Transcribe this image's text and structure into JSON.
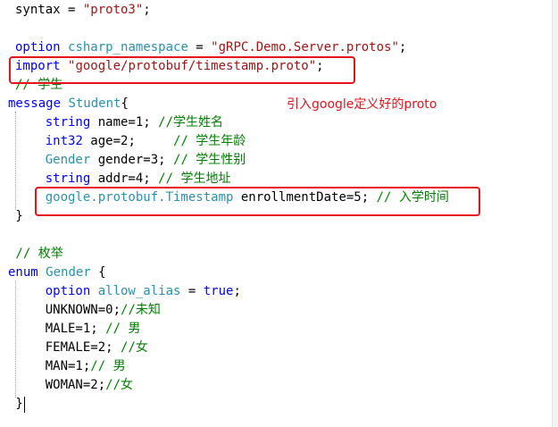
{
  "editor": {
    "lines": [
      [
        {
          "t": "syntax = ",
          "c": "pl"
        },
        {
          "t": "\"proto3\"",
          "c": "str"
        },
        {
          "t": ";",
          "c": "pl"
        }
      ],
      [],
      [
        {
          "t": "option ",
          "c": "kw"
        },
        {
          "t": "csharp_namespace",
          "c": "ty"
        },
        {
          "t": " = ",
          "c": "pl"
        },
        {
          "t": "\"gRPC.Demo.Server.protos\"",
          "c": "str"
        },
        {
          "t": ";",
          "c": "pl"
        }
      ],
      [
        {
          "t": "import ",
          "c": "kw"
        },
        {
          "t": "\"google/protobuf/timestamp.proto\"",
          "c": "str"
        },
        {
          "t": ";",
          "c": "pl"
        }
      ],
      [
        {
          "t": "// 学生",
          "c": "cm"
        }
      ],
      [
        {
          "t": "message ",
          "c": "kw"
        },
        {
          "t": "Student",
          "c": "ty"
        },
        {
          "t": "{",
          "c": "pl"
        }
      ],
      [
        {
          "t": "    string ",
          "c": "kw"
        },
        {
          "t": "name=1; ",
          "c": "pl"
        },
        {
          "t": "//学生姓名",
          "c": "cm"
        }
      ],
      [
        {
          "t": "    int32 ",
          "c": "kw"
        },
        {
          "t": "age=2;     ",
          "c": "pl"
        },
        {
          "t": "// 学生年龄",
          "c": "cm"
        }
      ],
      [
        {
          "t": "    Gender ",
          "c": "ty"
        },
        {
          "t": "gender=3; ",
          "c": "pl"
        },
        {
          "t": "// 学生性别",
          "c": "cm"
        }
      ],
      [
        {
          "t": "    string ",
          "c": "kw"
        },
        {
          "t": "addr=4; ",
          "c": "pl"
        },
        {
          "t": "// 学生地址",
          "c": "cm"
        }
      ],
      [
        {
          "t": "    google.protobuf.",
          "c": "ty"
        },
        {
          "t": "Timestamp",
          "c": "ty"
        },
        {
          "t": " enrollmentDate=5; ",
          "c": "pl"
        },
        {
          "t": "// 入学时间",
          "c": "cm"
        }
      ],
      [
        {
          "t": " }",
          "c": "pl"
        }
      ],
      [],
      [
        {
          "t": " // 枚举",
          "c": "cm"
        }
      ],
      [
        {
          "t": "enum ",
          "c": "kw"
        },
        {
          "t": "Gender",
          "c": "ty"
        },
        {
          "t": " {",
          "c": "pl"
        }
      ],
      [
        {
          "t": "    option ",
          "c": "kw"
        },
        {
          "t": "allow_alias",
          "c": "ty"
        },
        {
          "t": " = ",
          "c": "pl"
        },
        {
          "t": "true",
          "c": "kw"
        },
        {
          "t": ";",
          "c": "pl"
        }
      ],
      [
        {
          "t": "    UNKNOWN=0;",
          "c": "pl"
        },
        {
          "t": "//未知",
          "c": "cm"
        }
      ],
      [
        {
          "t": "    MALE=1; ",
          "c": "pl"
        },
        {
          "t": "// 男",
          "c": "cm"
        }
      ],
      [
        {
          "t": "    FEMALE=2; ",
          "c": "pl"
        },
        {
          "t": "//女",
          "c": "cm"
        }
      ],
      [
        {
          "t": "    MAN=1;",
          "c": "pl"
        },
        {
          "t": "// 男",
          "c": "cm"
        }
      ],
      [
        {
          "t": "    WOMAN=2;",
          "c": "pl"
        },
        {
          "t": "//女",
          "c": "cm"
        }
      ],
      [
        {
          "t": " }",
          "c": "pl"
        }
      ]
    ]
  },
  "annotation": {
    "text": "引入google定义好的proto"
  },
  "colors": {
    "keyword": "#0000ff",
    "string": "#a31515",
    "comment": "#008000",
    "type": "#2b91af",
    "highlight": "#e8121b"
  }
}
